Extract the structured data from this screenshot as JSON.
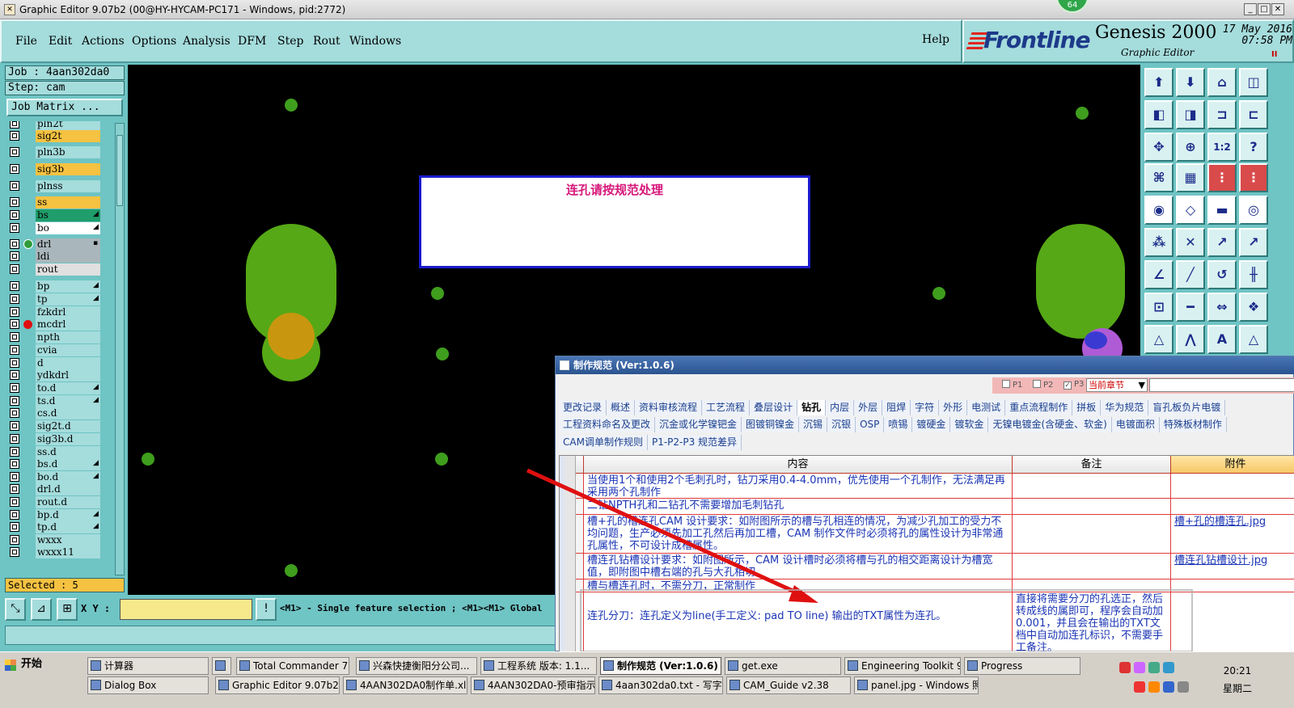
{
  "window": {
    "title": "Graphic Editor 9.07b2 (00@HY-HYCAM-PC171 - Windows, pid:2772)",
    "badge": "64"
  },
  "menu": {
    "items": [
      "File",
      "Edit",
      "Actions",
      "Options",
      "Analysis",
      "DFM",
      "Step",
      "Rout",
      "Windows"
    ],
    "help": "Help"
  },
  "brand": {
    "logo": "Frontline",
    "product": "Genesis 2000",
    "subtitle": "Graphic Editor",
    "date": "17 May 2016",
    "time": "07:58 PM",
    "pause": "II"
  },
  "job": {
    "job_line": "Job : 4aan302da0",
    "step_line": "Step: cam",
    "matrix_button": "Job Matrix ...",
    "selected": "Selected : 5"
  },
  "layers": [
    {
      "name": "pln2t",
      "bg": "#a5dcdc",
      "flag": "",
      "marker": ""
    },
    {
      "name": "sig2t",
      "bg": "#f5c242",
      "flag": "",
      "marker": ""
    },
    {
      "name": "pln3b",
      "bg": "#a5dcdc",
      "flag": "",
      "marker": ""
    },
    {
      "name": "sig3b",
      "bg": "#f5c242",
      "flag": "",
      "marker": ""
    },
    {
      "name": "plnss",
      "bg": "#a5dcdc",
      "flag": "",
      "marker": ""
    },
    {
      "name": "ss",
      "bg": "#f5c242",
      "flag": "",
      "marker": ""
    },
    {
      "name": "bs",
      "bg": "#1f9d6b",
      "flag": "◢",
      "marker": ""
    },
    {
      "name": "bo",
      "bg": "#ffffff",
      "flag": "◢",
      "marker": ""
    },
    {
      "name": "drl",
      "bg": "#a9b6bb",
      "flag": "▪",
      "marker": "drill"
    },
    {
      "name": "ldi",
      "bg": "#a9b6bb",
      "flag": "",
      "marker": ""
    },
    {
      "name": "rout",
      "bg": "#e0e0e0",
      "flag": "",
      "marker": ""
    },
    {
      "name": "bp",
      "bg": "#a5dcdc",
      "flag": "◢",
      "marker": ""
    },
    {
      "name": "tp",
      "bg": "#a5dcdc",
      "flag": "◢",
      "marker": ""
    },
    {
      "name": "fzkdrl",
      "bg": "#a5dcdc",
      "flag": "",
      "marker": ""
    },
    {
      "name": "mcdrl",
      "bg": "#a5dcdc",
      "flag": "",
      "marker": "red"
    },
    {
      "name": "npth",
      "bg": "#a5dcdc",
      "flag": "",
      "marker": ""
    },
    {
      "name": "cvia",
      "bg": "#a5dcdc",
      "flag": "",
      "marker": ""
    },
    {
      "name": "d",
      "bg": "#a5dcdc",
      "flag": "",
      "marker": ""
    },
    {
      "name": "ydkdrl",
      "bg": "#a5dcdc",
      "flag": "",
      "marker": ""
    },
    {
      "name": "to.d",
      "bg": "#a5dcdc",
      "flag": "◢",
      "marker": ""
    },
    {
      "name": "ts.d",
      "bg": "#a5dcdc",
      "flag": "◢",
      "marker": ""
    },
    {
      "name": "cs.d",
      "bg": "#a5dcdc",
      "flag": "",
      "marker": ""
    },
    {
      "name": "sig2t.d",
      "bg": "#a5dcdc",
      "flag": "",
      "marker": ""
    },
    {
      "name": "sig3b.d",
      "bg": "#a5dcdc",
      "flag": "",
      "marker": ""
    },
    {
      "name": "ss.d",
      "bg": "#a5dcdc",
      "flag": "",
      "marker": ""
    },
    {
      "name": "bs.d",
      "bg": "#a5dcdc",
      "flag": "◢",
      "marker": ""
    },
    {
      "name": "bo.d",
      "bg": "#a5dcdc",
      "flag": "◢",
      "marker": ""
    },
    {
      "name": "drl.d",
      "bg": "#a5dcdc",
      "flag": "",
      "marker": ""
    },
    {
      "name": "rout.d",
      "bg": "#a5dcdc",
      "flag": "",
      "marker": ""
    },
    {
      "name": "bp.d",
      "bg": "#a5dcdc",
      "flag": "◢",
      "marker": ""
    },
    {
      "name": "tp.d",
      "bg": "#a5dcdc",
      "flag": "◢",
      "marker": ""
    },
    {
      "name": "wxxx",
      "bg": "#a5dcdc",
      "flag": "",
      "marker": ""
    },
    {
      "name": "wxxx11",
      "bg": "#a5dcdc",
      "flag": "",
      "marker": ""
    }
  ],
  "canvas": {
    "alert_text": "连孔请按规范处理"
  },
  "bottom": {
    "xy_label": "X Y :",
    "xy_value": "",
    "status": "<M1> - Single feature selection ; <M1><M1> Global"
  },
  "dialog": {
    "title": "制作规范 (Ver:1.0.6)",
    "filters": {
      "p1": "P1",
      "p2": "P2",
      "p3": "P3",
      "chapter": "当前章节"
    },
    "tabs_row1": [
      "更改记录",
      "概述",
      "资料审核流程",
      "工艺流程",
      "叠层设计",
      "钻孔",
      "内层",
      "外层",
      "阻焊",
      "字符",
      "外形",
      "电测试",
      "重点流程制作",
      "拼板",
      "华为规范",
      "盲孔板负片电镀"
    ],
    "active_tab": "钻孔",
    "tabs_row2": [
      "工程资料命名及更改",
      "沉金或化学镍钯金",
      "图镀铜镍金",
      "沉锡",
      "沉银",
      "OSP",
      "喷锡",
      "镀硬金",
      "镀软金",
      "无镍电镀金(含硬金、软金)",
      "电镀面积",
      "特殊板材制作"
    ],
    "tabs_row3": [
      "CAM调单制作规则",
      "P1-P2-P3 规范差异"
    ],
    "columns": [
      "内容",
      "备注",
      "附件"
    ],
    "rows": [
      {
        "content": "当使用1个和使用2个毛刺孔时，钻刀采用0.4-4.0mm，优先使用一个孔制作，无法满足再采用两个孔制作",
        "note": "",
        "attachment": ""
      },
      {
        "content": "二钻NPTH孔和二钻孔不需要增加毛刺钻孔",
        "note": "",
        "attachment": ""
      },
      {
        "content": "槽+孔的槽连孔CAM 设计要求：如附图所示的槽与孔相连的情况，为减少孔加工的受力不均问题，生产必须先加工孔然后再加工槽，CAM 制作文件时必须将孔的属性设计为非常通孔属性，不可设计成槽属性。",
        "note": "",
        "attachment": "槽+孔的槽连孔.jpg"
      },
      {
        "content": "槽连孔钻槽设计要求：如附图所示，CAM 设计槽时必须将槽与孔的相交距离设计为槽宽值，即附图中槽右端的孔与大孔相切。",
        "note": "",
        "attachment": "槽连孔钻槽设计.jpg"
      },
      {
        "content": "槽与槽连孔时，不需分刀，正常制作",
        "note": "",
        "attachment": ""
      },
      {
        "content": "连孔分刀：连孔定义为line(手工定义: pad TO line) 输出的TXT属性为连孔。",
        "note": "直接将需要分刀的孔选正，然后转成线的属即可，程序会自动加0.001，并且会在输出的TXT文档中自动加连孔标识，不需要手工备注。",
        "attachment": ""
      }
    ]
  },
  "taskbar": {
    "start": "开始",
    "row1": [
      "计算器",
      "",
      "Total Commander 7.0 ...",
      "兴森快捷衡阳分公司...",
      "工程系统 版本: 1.1...",
      "制作规范 (Ver:1.0.6)",
      "get.exe",
      "Engineering Toolkit 9.0...",
      "Progress"
    ],
    "row2": [
      "Dialog Box",
      "Graphic Editor 9.07b2 (0...",
      "4AAN302DA0制作单.xls...",
      "4AAN302DA0-预审指示...",
      "4aan302da0.txt - 写字板",
      "CAM_Guide v2.38",
      "panel.jpg - Windows 照..."
    ],
    "time": "20:21",
    "day": "星期二"
  }
}
